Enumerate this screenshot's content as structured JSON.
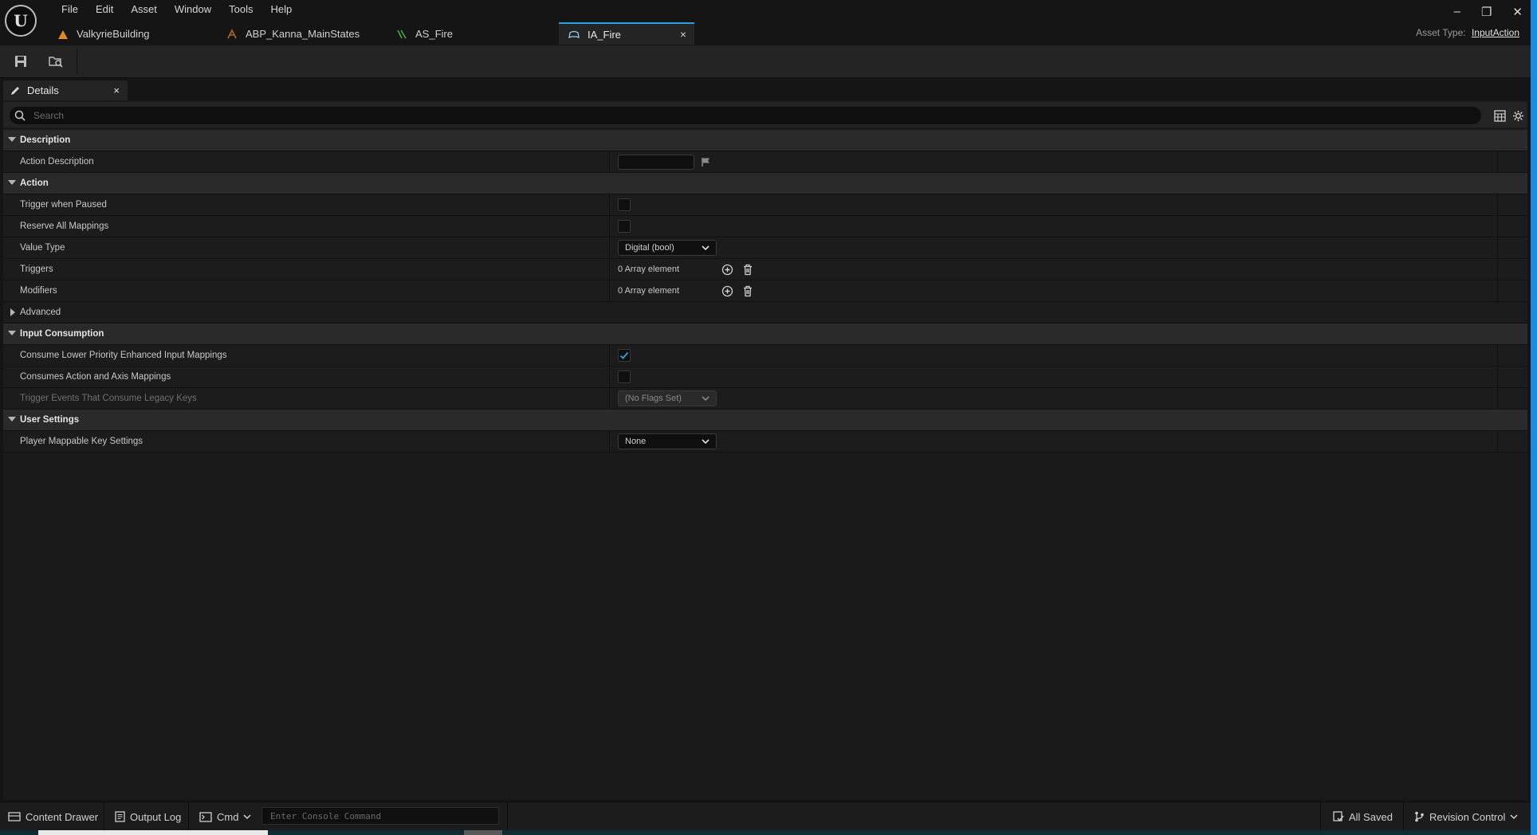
{
  "app": {
    "logo_text": "U",
    "menu": [
      "File",
      "Edit",
      "Asset",
      "Window",
      "Tools",
      "Help"
    ],
    "tabs": [
      {
        "label": "ValkyrieBuilding",
        "icon": "level-icon",
        "color": "#e08a2a"
      },
      {
        "label": "ABP_Kanna_MainStates",
        "icon": "anim-blueprint-icon",
        "color": "#b06a2a"
      },
      {
        "label": "AS_Fire",
        "icon": "anim-sequence-icon",
        "color": "#4fa84f"
      },
      {
        "label": "IA_Fire",
        "icon": "gamepad-icon",
        "color": "#8fd0e8",
        "active": true
      }
    ],
    "tab_close": "×",
    "asset_type_label": "Asset Type:",
    "asset_type_value": "InputAction",
    "window_controls": [
      "–",
      "❐",
      "✕"
    ]
  },
  "toolbar": {
    "buttons": [
      "save-icon",
      "browse-to-asset-icon"
    ]
  },
  "details": {
    "tab_label": "Details",
    "tab_close": "×",
    "search_placeholder": "Search",
    "sections": [
      {
        "name": "Description",
        "expanded": true,
        "props": [
          {
            "label": "Action Description",
            "type": "text",
            "value": ""
          }
        ]
      },
      {
        "name": "Action",
        "expanded": true,
        "props": [
          {
            "label": "Trigger when Paused",
            "type": "checkbox",
            "checked": false
          },
          {
            "label": "Reserve All Mappings",
            "type": "checkbox",
            "checked": false
          },
          {
            "label": "Value Type",
            "type": "combo",
            "value": "Digital (bool)"
          },
          {
            "label": "Triggers",
            "type": "array",
            "value": "0 Array element"
          },
          {
            "label": "Modifiers",
            "type": "array",
            "value": "0 Array element"
          },
          {
            "label": "Advanced",
            "type": "subcategory",
            "expanded": false
          }
        ]
      },
      {
        "name": "Input Consumption",
        "expanded": true,
        "props": [
          {
            "label": "Consume Lower Priority Enhanced Input Mappings",
            "type": "checkbox",
            "checked": true
          },
          {
            "label": "Consumes Action and Axis Mappings",
            "type": "checkbox",
            "checked": false
          },
          {
            "label": "Trigger Events That Consume Legacy Keys",
            "type": "combo",
            "value": "(No Flags Set)",
            "disabled": true
          }
        ]
      },
      {
        "name": "User Settings",
        "expanded": true,
        "props": [
          {
            "label": "Player Mappable Key Settings",
            "type": "combo",
            "value": "None"
          }
        ]
      }
    ]
  },
  "statusbar": {
    "content_drawer": "Content Drawer",
    "output_log": "Output Log",
    "cmd": "Cmd",
    "console_placeholder": "Enter Console Command",
    "all_saved": "All Saved",
    "revision_control": "Revision Control"
  },
  "colors": {
    "accent": "#2aa0e8",
    "checkbox_check": "#2aa0e8",
    "right_edge": "#1b8be0"
  }
}
